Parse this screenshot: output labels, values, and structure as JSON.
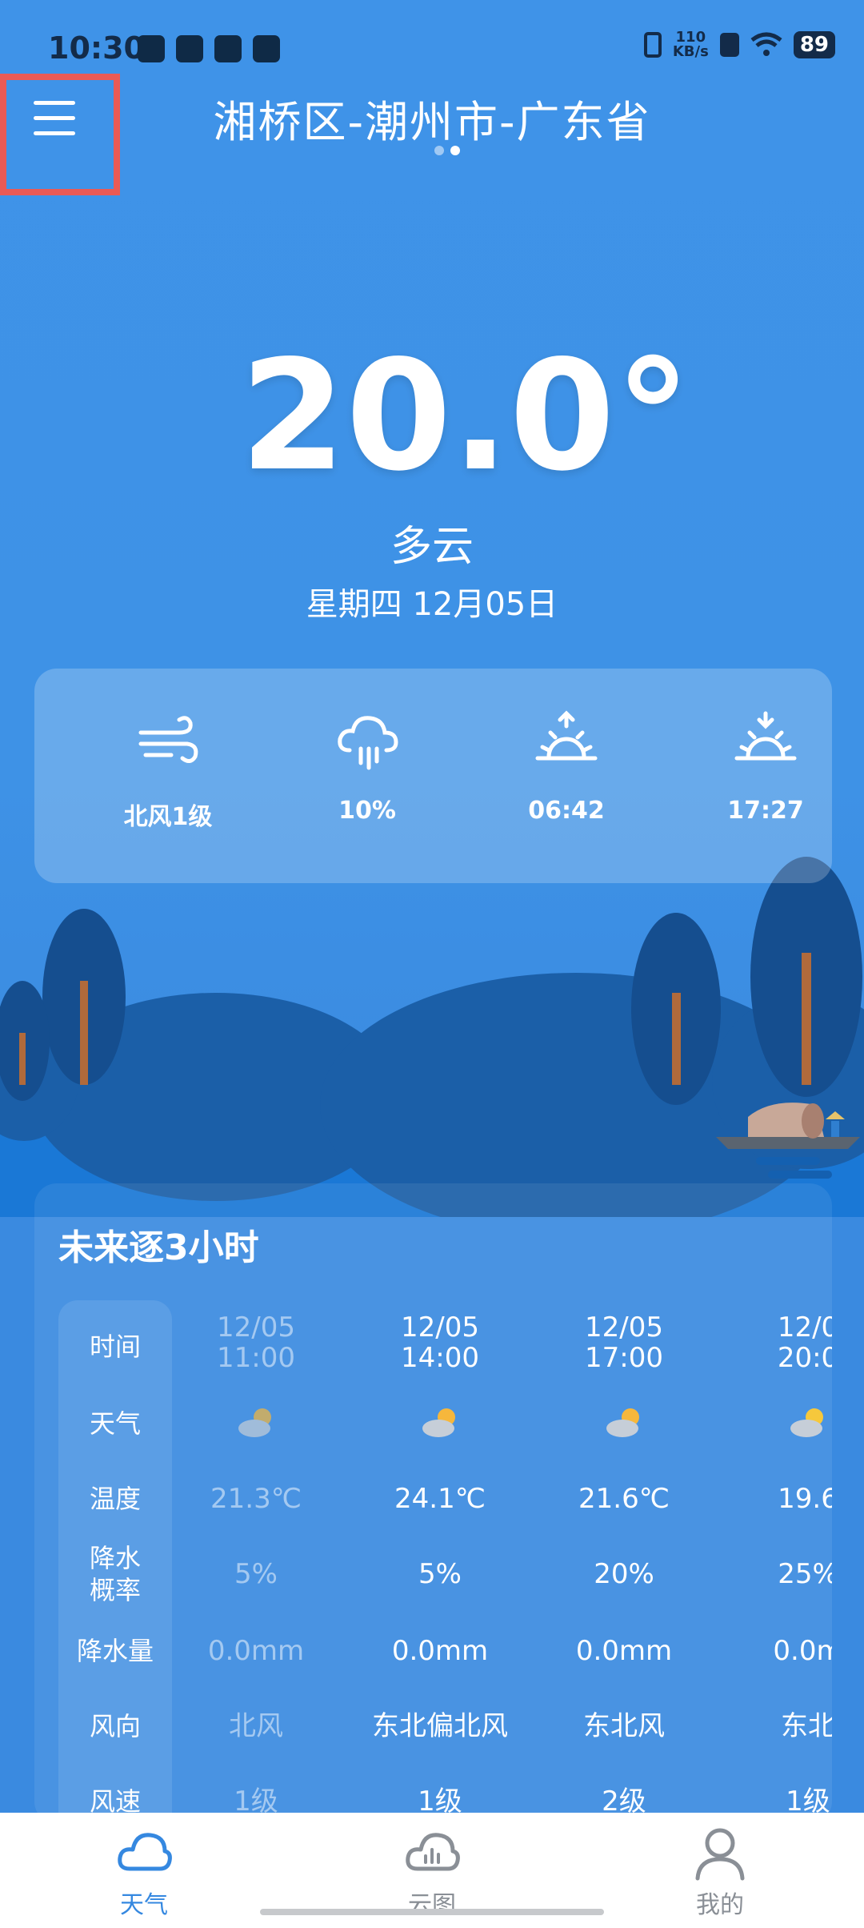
{
  "status_bar": {
    "time": "10:30",
    "net_speed": "110",
    "net_unit": "KB/s",
    "battery": "89"
  },
  "header": {
    "location": "湘桥区-潮州市-广东省",
    "page_dots": 2,
    "active_dot": 1
  },
  "current": {
    "temperature": "20.0°",
    "condition": "多云",
    "date": "星期四 12月05日"
  },
  "details": [
    {
      "icon": "wind-icon",
      "label": "北风1级"
    },
    {
      "icon": "rain-cloud-icon",
      "label": "10%"
    },
    {
      "icon": "sunrise-icon",
      "label": "06:42"
    },
    {
      "icon": "sunset-icon",
      "label": "17:27"
    }
  ],
  "forecast": {
    "title": "未来逐3小时",
    "row_labels": [
      "时间",
      "天气",
      "温度",
      "降水\n概率",
      "降水量",
      "风向",
      "风速"
    ],
    "columns": [
      {
        "date": "12/05",
        "time": "11:00",
        "icon": "partly-cloudy-icon",
        "temp": "21.3℃",
        "precip_prob": "5%",
        "precip": "0.0mm",
        "wind_dir": "北风",
        "wind_speed": "1级",
        "dim": true
      },
      {
        "date": "12/05",
        "time": "14:00",
        "icon": "partly-cloudy-icon",
        "temp": "24.1℃",
        "precip_prob": "5%",
        "precip": "0.0mm",
        "wind_dir": "东北偏北风",
        "wind_speed": "1级",
        "dim": false
      },
      {
        "date": "12/05",
        "time": "17:00",
        "icon": "partly-cloudy-icon",
        "temp": "21.6℃",
        "precip_prob": "20%",
        "precip": "0.0mm",
        "wind_dir": "东北风",
        "wind_speed": "2级",
        "dim": false
      },
      {
        "date": "12/0",
        "time": "20:0",
        "icon": "partly-cloudy-icon",
        "temp": "19.6",
        "precip_prob": "25%",
        "precip": "0.0m",
        "wind_dir": "东北",
        "wind_speed": "1级",
        "dim": false
      }
    ]
  },
  "nav": [
    {
      "icon": "cloud-icon",
      "label": "天气",
      "active": true
    },
    {
      "icon": "cloud-map-icon",
      "label": "云图",
      "active": false
    },
    {
      "icon": "profile-icon",
      "label": "我的",
      "active": false
    }
  ],
  "colors": {
    "accent": "#3588e0",
    "highlight_box": "#ea5a55",
    "sky": "#3f93e8"
  }
}
